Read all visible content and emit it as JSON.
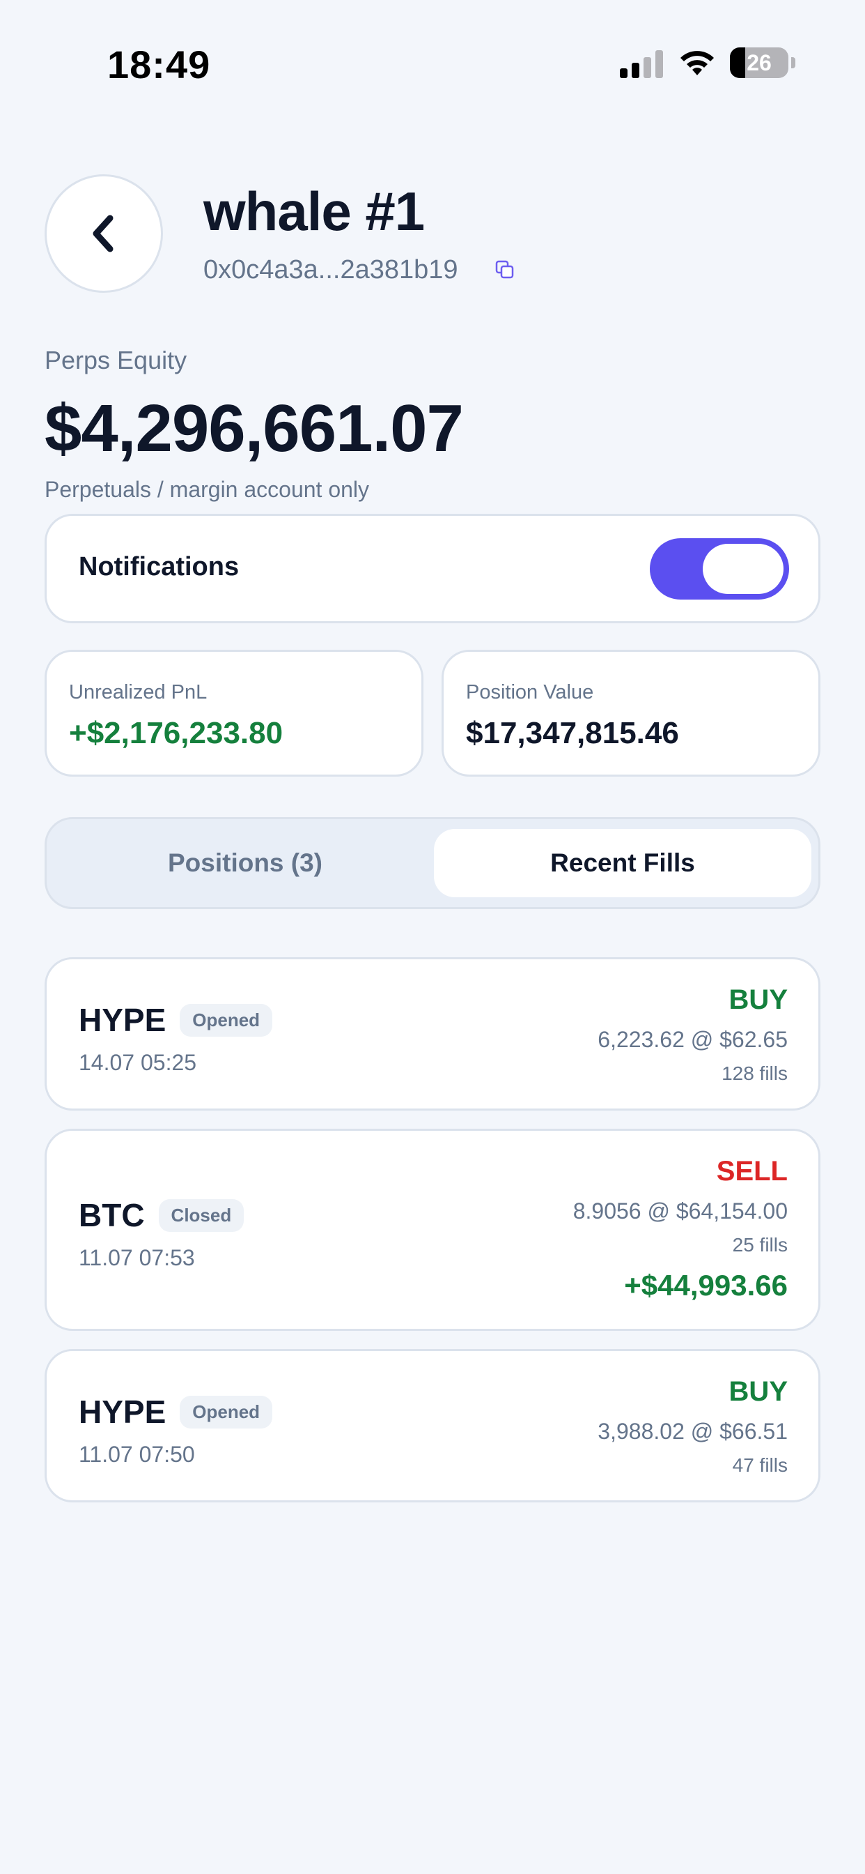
{
  "status_bar": {
    "time": "18:49",
    "battery": "26",
    "battery_level": 0.26,
    "icons": [
      "cellular-signal-icon",
      "wifi-icon",
      "battery-icon"
    ]
  },
  "header": {
    "back_icon": "chevron-left-icon",
    "title": "whale #1",
    "address": "0x0c4a3a...2a381b19",
    "copy_icon": "copy-icon"
  },
  "equity": {
    "label": "Perps Equity",
    "value": "$4,296,661.07",
    "note": "Perpetuals / margin account only"
  },
  "notifications": {
    "label": "Notifications",
    "enabled": true
  },
  "stats": {
    "unrealized_pnl": {
      "label": "Unrealized PnL",
      "value": "+$2,176,233.80"
    },
    "position_value": {
      "label": "Position Value",
      "value": "$17,347,815.46"
    }
  },
  "tabs": [
    {
      "label": "Positions (3)",
      "active": false
    },
    {
      "label": "Recent Fills",
      "active": true
    }
  ],
  "fills": [
    {
      "coin": "HYPE",
      "status": "Opened",
      "date": "14.07 05:25",
      "side": "BUY",
      "qty": "6,223.62 @ $62.65",
      "fills": "128 fills",
      "pnl": ""
    },
    {
      "coin": "BTC",
      "status": "Closed",
      "date": "11.07 07:53",
      "side": "SELL",
      "qty": "8.9056 @ $64,154.00",
      "fills": "25 fills",
      "pnl": "+$44,993.66"
    },
    {
      "coin": "HYPE",
      "status": "Opened",
      "date": "11.07 07:50",
      "side": "BUY",
      "qty": "3,988.02 @ $66.51",
      "fills": "47 fills",
      "pnl": ""
    }
  ],
  "colors": {
    "accent": "#5b4ff0",
    "positive": "#15803d",
    "negative": "#dc2626",
    "background": "#f3f6fb"
  }
}
